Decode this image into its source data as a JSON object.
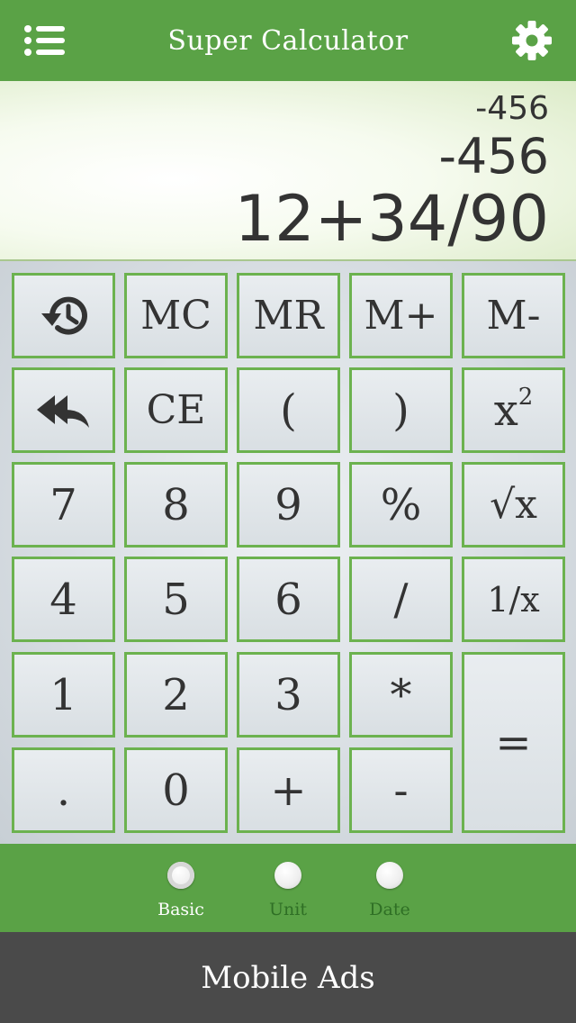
{
  "header": {
    "title": "Super Calculator",
    "menu_icon": "list-menu-icon",
    "settings_icon": "gear-icon"
  },
  "display": {
    "memory_line": "-456",
    "result_line": "-456",
    "expression_line": "12+34/90"
  },
  "keys": {
    "history_icon": "history-icon",
    "mc": "MC",
    "mr": "MR",
    "m_plus": "M+",
    "m_minus": "M-",
    "backspace_icon": "reply-all-icon",
    "ce": "CE",
    "open_paren": "(",
    "close_paren": ")",
    "square_base": "x",
    "square_exp": "2",
    "seven": "7",
    "eight": "8",
    "nine": "9",
    "percent": "%",
    "sqrt": "√x",
    "four": "4",
    "five": "5",
    "six": "6",
    "divide": "/",
    "reciprocal": "1/x",
    "one": "1",
    "two": "2",
    "three": "3",
    "multiply": "*",
    "equals": "=",
    "decimal": ".",
    "zero": "0",
    "plus": "+",
    "minus": "-"
  },
  "tabs": [
    {
      "label": "Basic",
      "active": true
    },
    {
      "label": "Unit",
      "active": false
    },
    {
      "label": "Date",
      "active": false
    }
  ],
  "ads": {
    "label": "Mobile Ads"
  },
  "colors": {
    "primary_green": "#5aa246",
    "key_border": "#6cb24f",
    "ads_bar": "#4a4a4a",
    "text_dark": "#333333"
  }
}
